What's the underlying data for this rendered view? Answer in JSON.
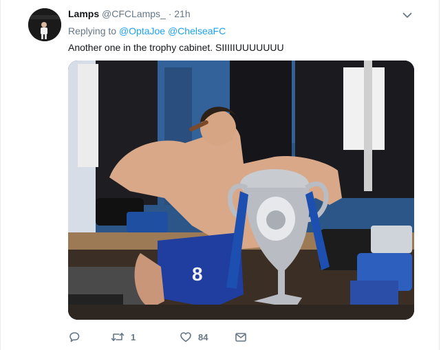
{
  "tweet": {
    "display_name": "Lamps",
    "handle": "@CFCLamps_",
    "separator": "·",
    "timestamp": "21h",
    "replying_to_label": "Replying to",
    "mentions": [
      "@OptaJoe",
      "@ChelseaFC"
    ],
    "text": "Another one in the trophy cabinet. SIIIIIUUUUUUU",
    "media_alt": "",
    "actions": {
      "reply_count": "",
      "retweet_count": "1",
      "like_count": "84"
    }
  },
  "colors": {
    "link": "#1da1f2",
    "secondary_text": "#657786",
    "primary_text": "#14171a"
  },
  "icons": [
    "avatar-image",
    "chevron-down-icon",
    "reply-icon",
    "retweet-icon",
    "like-icon",
    "direct-message-icon"
  ]
}
